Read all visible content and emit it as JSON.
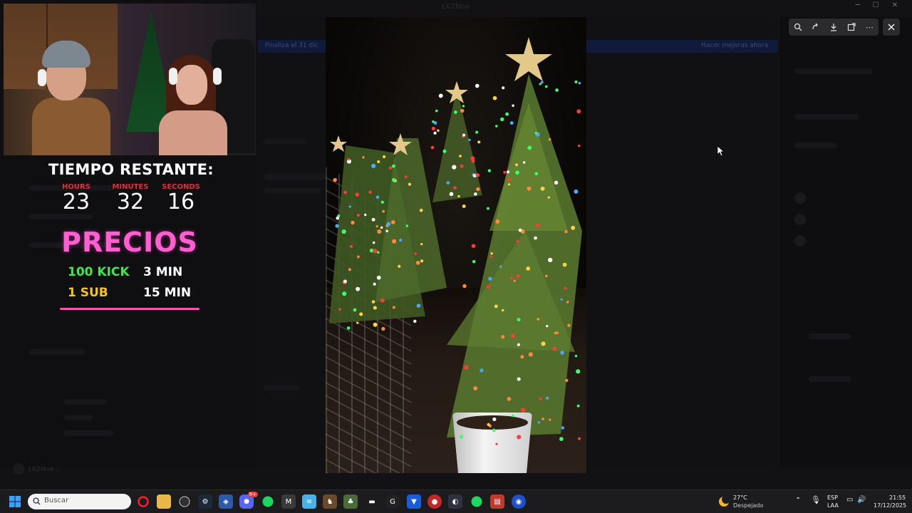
{
  "window": {
    "title": "LKZNoa"
  },
  "background_app": {
    "banner_left": "Finaliza el 31 dic",
    "banner_right": "Hacer mejoras ahora",
    "sidebar_user": "LKZNoa..."
  },
  "viewer": {
    "toolbar": [
      "zoom-in-icon",
      "rotate-icon",
      "download-icon",
      "open-external-icon",
      "more-icon"
    ],
    "close_icon": "close-icon"
  },
  "overlay": {
    "timer_title": "TIEMPO RESTANTE:",
    "timer": [
      {
        "label": "HOURS",
        "value": "23"
      },
      {
        "label": "MINUTES",
        "value": "32"
      },
      {
        "label": "SECONDS",
        "value": "16"
      }
    ],
    "prices_title": "PRECIOS",
    "prices": [
      {
        "item": "100 KICK",
        "time": "3 MIN",
        "color": "#3ee84a"
      },
      {
        "item": "1 SUB",
        "time": "15 MIN",
        "color": "#f5c518"
      }
    ]
  },
  "taskbar": {
    "search_placeholder": "Buscar",
    "apps": [
      "windows-start-icon",
      "opera-icon",
      "file-explorer-icon",
      "obs-icon",
      "steam-icon",
      "app-shield-icon",
      "discord-icon",
      "spotify-icon",
      "app-m-icon",
      "notepad-icon",
      "game-icon",
      "game-icon-2",
      "car-icon",
      "app-g-icon",
      "bitwarden-icon",
      "app-red-icon",
      "app-dark-icon",
      "spotify-icon-2",
      "app-news-icon",
      "app-blue-icon"
    ],
    "discord_badge": "9+",
    "weather_temp": "27°C",
    "weather_desc": "Despejado",
    "lang_1": "ESP",
    "lang_2": "LAA",
    "time": "21:55",
    "date": "17/12/2025"
  }
}
